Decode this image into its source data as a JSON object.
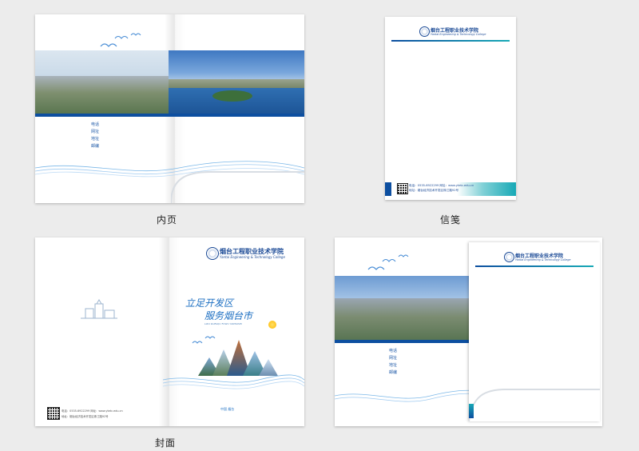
{
  "captions": {
    "inner_page": "内页",
    "letter_paper": "信笺",
    "cover": "封面"
  },
  "school": {
    "name_cn": "烟台工程职业技术学院",
    "name_en": "Yantai Engineering & Technology College"
  },
  "cover": {
    "slogan_line1": "立足开发区",
    "slogan_line2": "服务烟台市",
    "slogan_small": "LIZU KAIFAQU FUWU YANTAISHI",
    "footer_small": "中国 烟台"
  },
  "letter": {
    "footer_phone": "电话：0535-6922299  网址：www.ytetc.edu.cn",
    "footer_addr": "地址：烟台经济技术开发区珠江路92号"
  },
  "contact_labels": [
    "电话",
    "网址",
    "地址",
    "邮编"
  ],
  "colors": {
    "brand_blue": "#0d4fa0",
    "teal": "#17a9b6",
    "text_blue": "#1b4a96"
  }
}
